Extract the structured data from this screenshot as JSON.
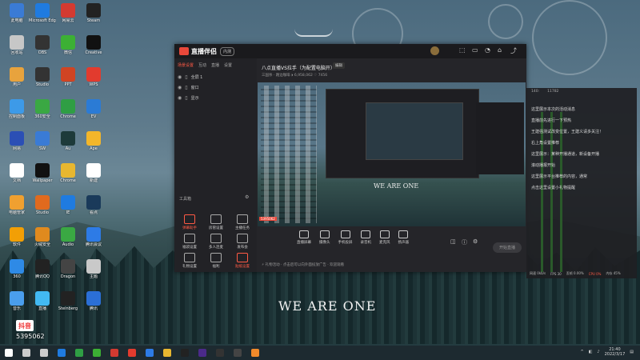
{
  "wallpaper": {
    "text": "WE ARE ONE"
  },
  "desktop_icons": [
    {
      "label": "此电脑",
      "color": "#3a7bd5",
      "col": 0,
      "row": 0
    },
    {
      "label": "回收站",
      "color": "#c7c7c7",
      "col": 0,
      "row": 1
    },
    {
      "label": "用户",
      "color": "#e8a33d",
      "col": 0,
      "row": 2
    },
    {
      "label": "控制面板",
      "color": "#3d9ae8",
      "col": 0,
      "row": 3
    },
    {
      "label": "网易",
      "color": "#2b4fb5",
      "col": 0,
      "row": 4
    },
    {
      "label": "文档",
      "color": "#ffffff",
      "col": 0,
      "row": 5
    },
    {
      "label": "电脑管家",
      "color": "#f0a030",
      "col": 0,
      "row": 6
    },
    {
      "label": "软件",
      "color": "#f29f05",
      "col": 0,
      "row": 7
    },
    {
      "label": "360",
      "color": "#2e8ae6",
      "col": 0,
      "row": 8
    },
    {
      "label": "音乐",
      "color": "#4a9eed",
      "col": 0,
      "row": 9
    },
    {
      "label": "Microsoft Edge",
      "color": "#1f7be0",
      "col": 1,
      "row": 0
    },
    {
      "label": "OBS",
      "color": "#333333",
      "col": 1,
      "row": 1
    },
    {
      "label": "Studio",
      "color": "#333333",
      "col": 1,
      "row": 2
    },
    {
      "label": "360安全",
      "color": "#3aa843",
      "col": 1,
      "row": 3
    },
    {
      "label": "SW",
      "color": "#3a7bd5",
      "col": 1,
      "row": 4
    },
    {
      "label": "Wallpaper",
      "color": "#111111",
      "col": 1,
      "row": 5
    },
    {
      "label": "Studio",
      "color": "#e06a1e",
      "col": 1,
      "row": 6
    },
    {
      "label": "火绒安全",
      "color": "#e08a1e",
      "col": 1,
      "row": 7
    },
    {
      "label": "腾讯QQ",
      "color": "#222222",
      "col": 1,
      "row": 8
    },
    {
      "label": "直播",
      "color": "#42b9f2",
      "col": 1,
      "row": 9
    },
    {
      "label": "网易云",
      "color": "#d33a31",
      "col": 2,
      "row": 0
    },
    {
      "label": "微信",
      "color": "#3cb034",
      "col": 2,
      "row": 1
    },
    {
      "label": "PPT",
      "color": "#d04423",
      "col": 2,
      "row": 2
    },
    {
      "label": "Chrome",
      "color": "#2f9e44",
      "col": 2,
      "row": 3
    },
    {
      "label": "Au",
      "color": "#1d3a3a",
      "col": 2,
      "row": 4
    },
    {
      "label": "Chrome",
      "color": "#e8b730",
      "col": 2,
      "row": 5
    },
    {
      "label": "IE",
      "color": "#1f7be0",
      "col": 2,
      "row": 6
    },
    {
      "label": "Audio",
      "color": "#3aa843",
      "col": 2,
      "row": 7
    },
    {
      "label": "Dragon",
      "color": "#444444",
      "col": 2,
      "row": 8
    },
    {
      "label": "Steinberg",
      "color": "#222222",
      "col": 2,
      "row": 9
    },
    {
      "label": "Steam",
      "color": "#222222",
      "col": 3,
      "row": 0
    },
    {
      "label": "Creative",
      "color": "#111111",
      "col": 3,
      "row": 1
    },
    {
      "label": "WPS",
      "color": "#e23b2e",
      "col": 3,
      "row": 2
    },
    {
      "label": "EV",
      "color": "#2b7bd5",
      "col": 3,
      "row": 3
    },
    {
      "label": "Ape",
      "color": "#f3b62a",
      "col": 3,
      "row": 4
    },
    {
      "label": "新建",
      "color": "#ffffff",
      "col": 3,
      "row": 5
    },
    {
      "label": "看点",
      "color": "#1a3a5a",
      "col": 3,
      "row": 6
    },
    {
      "label": "腾讯会议",
      "color": "#2d7be6",
      "col": 3,
      "row": 7
    },
    {
      "label": "主题",
      "color": "#c9c9c9",
      "col": 3,
      "row": 8
    },
    {
      "label": "腾讯",
      "color": "#2b6fd6",
      "col": 3,
      "row": 9
    }
  ],
  "app": {
    "name": "直播伴侣",
    "badge": "内测",
    "left_tabs": [
      "场景设置",
      "互动",
      "直播",
      "设置"
    ],
    "scenes": [
      "全屏 1",
      "窗口",
      "显示"
    ],
    "toolbox_title": "工具箱",
    "tools": [
      "弹幕助手",
      "房管设置",
      "主播任务",
      "福袋设置",
      "多人连麦",
      "发布会",
      "礼物设置",
      "福利",
      "贴纸设置"
    ],
    "stream_title": "八点直播VS拉手（为配置电脑开）",
    "stream_edit": "编辑",
    "stream_sub": "三国杀 · 路边咖啡  ⏵ 6,958,062  ♡ 7456",
    "preview_text": "WE ARE ONE",
    "preview_badge": "5395062",
    "bottom_tools": [
      "直播屏幕",
      "摄像头",
      "手机投屏",
      "录音机",
      "麦克风",
      "扬声器"
    ],
    "start_label": "开始直播",
    "footer": "⚡ 礼物活动  ·  点击后可以向外面投放广告  ·  欢迎观看"
  },
  "chat": {
    "head": [
      "140:",
      "11782"
    ],
    "lines": [
      "这里展示本次的活动消息",
      "直播前先进行一下预热",
      "王建强测试改变位置，王建义请多关注！",
      "右上角设置推荐",
      "这里展示：某种开播通道，新设备开播",
      "滚动播报开始",
      "这里展示平台推荐的内容，通常",
      "点击这里设置小礼物提醒"
    ],
    "footer": [
      "网速 0kb/s",
      "FPS 30",
      "丢帧 0.00%",
      "CPU 0%",
      "内存 45%"
    ]
  },
  "tiktok": {
    "name": "抖音",
    "id": "5395062"
  },
  "taskbar": {
    "time": "21:40",
    "date": "2022/3/17",
    "icons": [
      "start",
      "search",
      "taskview",
      "edge",
      "chrome",
      "wechat",
      "netease",
      "music",
      "tencent",
      "explorer",
      "steam",
      "pr",
      "studio",
      "obs",
      "live"
    ]
  }
}
